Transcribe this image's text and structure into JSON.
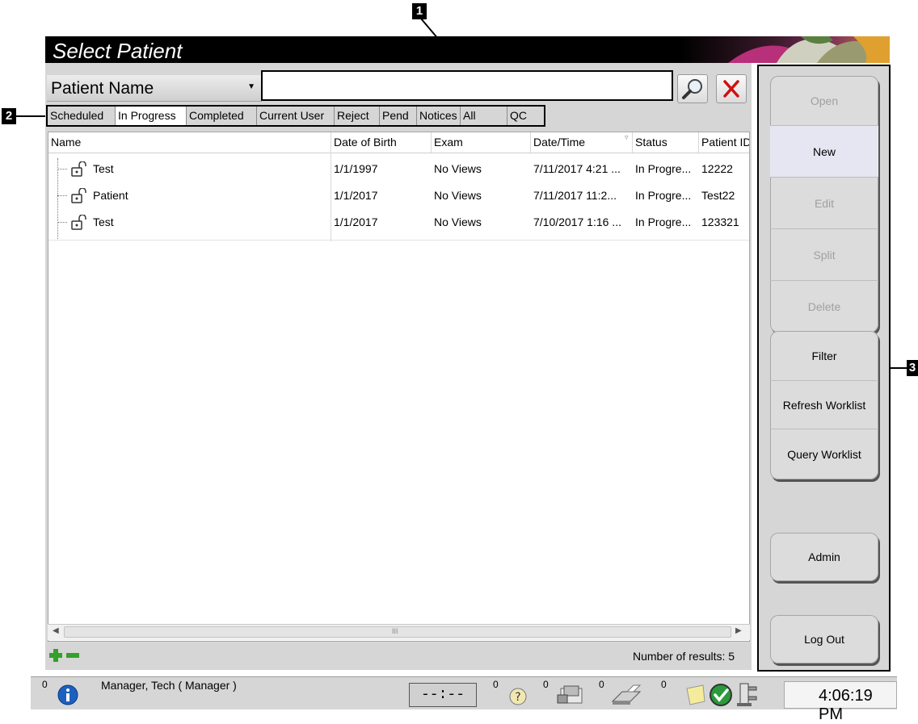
{
  "window": {
    "title": "Select Patient"
  },
  "search": {
    "field_selected": "Patient Name",
    "value": "",
    "placeholder": ""
  },
  "callouts": [
    "1",
    "2",
    "3"
  ],
  "tabs": [
    {
      "label": "Scheduled",
      "active": false
    },
    {
      "label": "In Progress",
      "active": true
    },
    {
      "label": "Completed",
      "active": false
    },
    {
      "label": "Current User",
      "active": false
    },
    {
      "label": "Reject",
      "active": false
    },
    {
      "label": "Pend",
      "active": false
    },
    {
      "label": "Notices",
      "active": false
    },
    {
      "label": "All",
      "active": false
    },
    {
      "label": "QC",
      "active": false
    }
  ],
  "table": {
    "columns": [
      "Name",
      "Date of Birth",
      "Exam",
      "Date/Time",
      "Status",
      "Patient ID"
    ],
    "rows": [
      [
        "Test",
        "1/1/1997",
        "No Views",
        "7/11/2017 4:21 ...",
        "In Progre...",
        "12222"
      ],
      [
        "Patient",
        "1/1/2017",
        "No Views",
        "7/11/2017 11:2...",
        "In Progre...",
        "Test22"
      ],
      [
        "Test",
        "1/1/2017",
        "No Views",
        "7/10/2017 1:16 ...",
        "In Progre...",
        "123321"
      ]
    ],
    "scroll_thumb_glyph": "III"
  },
  "footer": {
    "results_text": "Number of results: 5"
  },
  "actions": {
    "group1": [
      {
        "label": "Open",
        "state": "disabled"
      },
      {
        "label": "New",
        "state": "selected"
      },
      {
        "label": "Edit",
        "state": "disabled"
      },
      {
        "label": "Split",
        "state": "disabled"
      },
      {
        "label": "Delete",
        "state": "disabled"
      }
    ],
    "group2": [
      {
        "label": "Filter",
        "state": "enabled"
      },
      {
        "label": "Refresh Worklist",
        "state": "enabled"
      },
      {
        "label": "Query Worklist",
        "state": "enabled"
      }
    ],
    "admin": "Admin",
    "logout": "Log Out"
  },
  "statusbar": {
    "alert_count": "0",
    "user": "Manager, Tech ( Manager )",
    "timer": "--:--",
    "counts": [
      "0",
      "0",
      "0",
      "0"
    ],
    "time": "4:06:19 PM"
  },
  "colors": {
    "panel": "#d6d6d6",
    "callout": "#000000",
    "close_red": "#d01010",
    "add_green": "#33a02c"
  }
}
